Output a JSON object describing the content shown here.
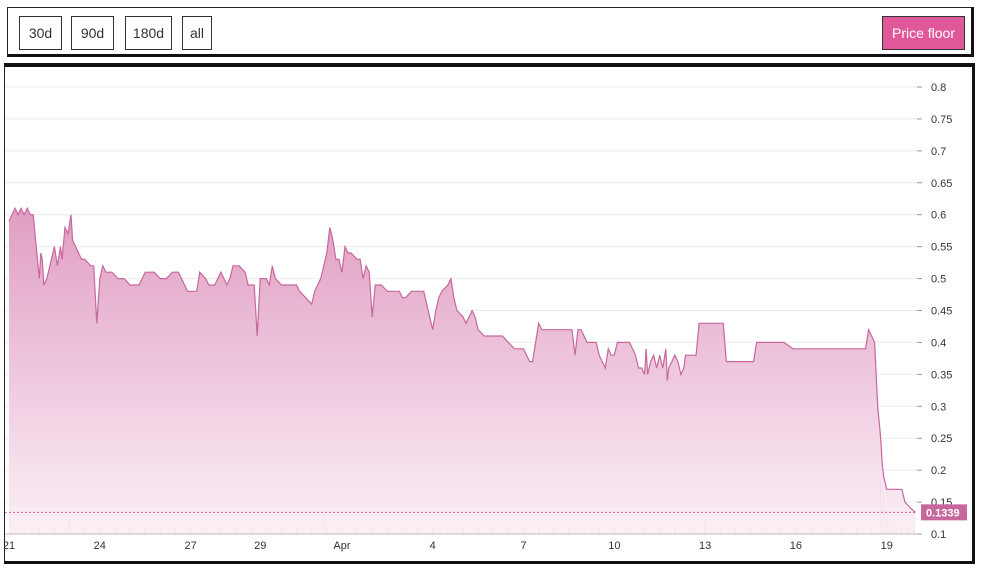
{
  "toolbar": {
    "range_buttons": [
      {
        "label": "30d",
        "active": true
      },
      {
        "label": "90d",
        "active": false
      },
      {
        "label": "180d",
        "active": false
      },
      {
        "label": "all",
        "active": false
      }
    ],
    "price_floor_label": "Price floor"
  },
  "colors": {
    "accent": "#e0589a",
    "line": "#c8679d",
    "fill": "#e4a3c6",
    "volume": "#c9a3b8"
  },
  "chart_data": {
    "type": "area",
    "title": "",
    "xlabel": "",
    "ylabel": "",
    "ylim": [
      0.1,
      0.8
    ],
    "y_ticks": [
      "0.1",
      "0.15",
      "0.2",
      "0.25",
      "0.3",
      "0.35",
      "0.4",
      "0.45",
      "0.5",
      "0.55",
      "0.6",
      "0.65",
      "0.7",
      "0.75",
      "0.8"
    ],
    "x_ticks": [
      {
        "label": "21",
        "day": 0
      },
      {
        "label": "24",
        "day": 3
      },
      {
        "label": "27",
        "day": 6
      },
      {
        "label": "29",
        "day": 8.3
      },
      {
        "label": "Apr",
        "day": 11
      },
      {
        "label": "4",
        "day": 14
      },
      {
        "label": "7",
        "day": 17
      },
      {
        "label": "10",
        "day": 20
      },
      {
        "label": "13",
        "day": 23
      },
      {
        "label": "16",
        "day": 26
      },
      {
        "label": "19",
        "day": 29
      }
    ],
    "current_price_label": "0.1339",
    "current_price": 0.1339,
    "grid": true,
    "series": [
      {
        "points": [
          [
            0,
            0.59
          ],
          [
            0.1,
            0.6
          ],
          [
            0.2,
            0.61
          ],
          [
            0.3,
            0.6
          ],
          [
            0.4,
            0.61
          ],
          [
            0.5,
            0.6
          ],
          [
            0.6,
            0.61
          ],
          [
            0.7,
            0.6
          ],
          [
            0.8,
            0.6
          ],
          [
            0.9,
            0.55
          ],
          [
            1.0,
            0.5
          ],
          [
            1.05,
            0.54
          ],
          [
            1.1,
            0.53
          ],
          [
            1.15,
            0.49
          ],
          [
            1.25,
            0.5
          ],
          [
            1.4,
            0.53
          ],
          [
            1.5,
            0.55
          ],
          [
            1.6,
            0.52
          ],
          [
            1.7,
            0.55
          ],
          [
            1.75,
            0.53
          ],
          [
            1.85,
            0.58
          ],
          [
            1.95,
            0.57
          ],
          [
            2.05,
            0.6
          ],
          [
            2.1,
            0.56
          ],
          [
            2.2,
            0.55
          ],
          [
            2.3,
            0.54
          ],
          [
            2.4,
            0.53
          ],
          [
            2.5,
            0.53
          ],
          [
            2.7,
            0.52
          ],
          [
            2.8,
            0.52
          ],
          [
            2.9,
            0.43
          ],
          [
            3.0,
            0.5
          ],
          [
            3.1,
            0.52
          ],
          [
            3.2,
            0.51
          ],
          [
            3.4,
            0.51
          ],
          [
            3.6,
            0.5
          ],
          [
            3.8,
            0.5
          ],
          [
            4.0,
            0.49
          ],
          [
            4.3,
            0.49
          ],
          [
            4.5,
            0.51
          ],
          [
            4.8,
            0.51
          ],
          [
            5.0,
            0.5
          ],
          [
            5.2,
            0.5
          ],
          [
            5.4,
            0.51
          ],
          [
            5.6,
            0.51
          ],
          [
            5.7,
            0.5
          ],
          [
            5.9,
            0.48
          ],
          [
            6.0,
            0.48
          ],
          [
            6.2,
            0.48
          ],
          [
            6.3,
            0.51
          ],
          [
            6.5,
            0.5
          ],
          [
            6.6,
            0.49
          ],
          [
            6.8,
            0.49
          ],
          [
            6.9,
            0.5
          ],
          [
            7.0,
            0.51
          ],
          [
            7.2,
            0.49
          ],
          [
            7.3,
            0.5
          ],
          [
            7.4,
            0.52
          ],
          [
            7.6,
            0.52
          ],
          [
            7.8,
            0.51
          ],
          [
            7.9,
            0.49
          ],
          [
            8.1,
            0.49
          ],
          [
            8.2,
            0.41
          ],
          [
            8.3,
            0.5
          ],
          [
            8.5,
            0.5
          ],
          [
            8.6,
            0.49
          ],
          [
            8.7,
            0.52
          ],
          [
            8.8,
            0.5
          ],
          [
            9.0,
            0.49
          ],
          [
            9.3,
            0.49
          ],
          [
            9.5,
            0.49
          ],
          [
            9.6,
            0.48
          ],
          [
            9.8,
            0.47
          ],
          [
            10.0,
            0.46
          ],
          [
            10.1,
            0.48
          ],
          [
            10.3,
            0.5
          ],
          [
            10.5,
            0.54
          ],
          [
            10.6,
            0.58
          ],
          [
            10.7,
            0.56
          ],
          [
            10.8,
            0.53
          ],
          [
            10.9,
            0.53
          ],
          [
            11.0,
            0.51
          ],
          [
            11.1,
            0.55
          ],
          [
            11.2,
            0.54
          ],
          [
            11.3,
            0.54
          ],
          [
            11.5,
            0.53
          ],
          [
            11.6,
            0.53
          ],
          [
            11.7,
            0.5
          ],
          [
            11.8,
            0.52
          ],
          [
            11.9,
            0.51
          ],
          [
            12.0,
            0.44
          ],
          [
            12.1,
            0.49
          ],
          [
            12.3,
            0.49
          ],
          [
            12.5,
            0.48
          ],
          [
            12.7,
            0.48
          ],
          [
            12.9,
            0.48
          ],
          [
            13.0,
            0.47
          ],
          [
            13.1,
            0.47
          ],
          [
            13.3,
            0.48
          ],
          [
            13.5,
            0.48
          ],
          [
            13.7,
            0.48
          ],
          [
            13.8,
            0.46
          ],
          [
            14.0,
            0.42
          ],
          [
            14.1,
            0.45
          ],
          [
            14.2,
            0.47
          ],
          [
            14.3,
            0.48
          ],
          [
            14.5,
            0.49
          ],
          [
            14.6,
            0.5
          ],
          [
            14.7,
            0.47
          ],
          [
            14.8,
            0.45
          ],
          [
            15.0,
            0.44
          ],
          [
            15.1,
            0.43
          ],
          [
            15.2,
            0.44
          ],
          [
            15.3,
            0.45
          ],
          [
            15.4,
            0.44
          ],
          [
            15.5,
            0.42
          ],
          [
            15.7,
            0.41
          ],
          [
            15.9,
            0.41
          ],
          [
            16.1,
            0.41
          ],
          [
            16.3,
            0.41
          ],
          [
            16.5,
            0.4
          ],
          [
            16.7,
            0.39
          ],
          [
            16.9,
            0.39
          ],
          [
            17.0,
            0.39
          ],
          [
            17.1,
            0.38
          ],
          [
            17.2,
            0.37
          ],
          [
            17.3,
            0.37
          ],
          [
            17.4,
            0.4
          ],
          [
            17.5,
            0.43
          ],
          [
            17.6,
            0.42
          ],
          [
            17.8,
            0.42
          ],
          [
            18.0,
            0.42
          ],
          [
            18.2,
            0.42
          ],
          [
            18.4,
            0.42
          ],
          [
            18.6,
            0.42
          ],
          [
            18.7,
            0.38
          ],
          [
            18.8,
            0.42
          ],
          [
            18.9,
            0.42
          ],
          [
            19.0,
            0.41
          ],
          [
            19.1,
            0.4
          ],
          [
            19.3,
            0.4
          ],
          [
            19.4,
            0.4
          ],
          [
            19.5,
            0.38
          ],
          [
            19.6,
            0.37
          ],
          [
            19.7,
            0.36
          ],
          [
            19.8,
            0.39
          ],
          [
            19.9,
            0.38
          ],
          [
            20.0,
            0.38
          ],
          [
            20.1,
            0.4
          ],
          [
            20.3,
            0.4
          ],
          [
            20.5,
            0.4
          ],
          [
            20.6,
            0.39
          ],
          [
            20.7,
            0.38
          ],
          [
            20.8,
            0.36
          ],
          [
            20.9,
            0.36
          ],
          [
            21.0,
            0.35
          ],
          [
            21.05,
            0.39
          ],
          [
            21.1,
            0.35
          ],
          [
            21.2,
            0.37
          ],
          [
            21.3,
            0.38
          ],
          [
            21.4,
            0.36
          ],
          [
            21.5,
            0.38
          ],
          [
            21.6,
            0.36
          ],
          [
            21.7,
            0.39
          ],
          [
            21.75,
            0.34
          ],
          [
            21.8,
            0.36
          ],
          [
            21.9,
            0.37
          ],
          [
            22.0,
            0.38
          ],
          [
            22.1,
            0.37
          ],
          [
            22.2,
            0.35
          ],
          [
            22.3,
            0.36
          ],
          [
            22.35,
            0.38
          ],
          [
            22.5,
            0.38
          ],
          [
            22.7,
            0.38
          ],
          [
            22.8,
            0.43
          ],
          [
            23.0,
            0.43
          ],
          [
            23.2,
            0.43
          ],
          [
            23.4,
            0.43
          ],
          [
            23.6,
            0.43
          ],
          [
            23.7,
            0.37
          ],
          [
            24.0,
            0.37
          ],
          [
            24.3,
            0.37
          ],
          [
            24.6,
            0.37
          ],
          [
            24.7,
            0.4
          ],
          [
            25.0,
            0.4
          ],
          [
            25.3,
            0.4
          ],
          [
            25.6,
            0.4
          ],
          [
            25.9,
            0.39
          ],
          [
            26.2,
            0.39
          ],
          [
            26.5,
            0.39
          ],
          [
            26.8,
            0.39
          ],
          [
            27.0,
            0.39
          ],
          [
            27.3,
            0.39
          ],
          [
            27.6,
            0.39
          ],
          [
            27.8,
            0.39
          ],
          [
            28.0,
            0.39
          ],
          [
            28.3,
            0.39
          ],
          [
            28.4,
            0.42
          ],
          [
            28.5,
            0.41
          ],
          [
            28.6,
            0.4
          ],
          [
            28.7,
            0.3
          ],
          [
            28.8,
            0.25
          ],
          [
            28.85,
            0.21
          ],
          [
            28.9,
            0.19
          ],
          [
            29.0,
            0.17
          ],
          [
            29.2,
            0.17
          ],
          [
            29.5,
            0.17
          ],
          [
            29.6,
            0.15
          ],
          [
            29.8,
            0.14
          ],
          [
            29.95,
            0.1339
          ]
        ]
      }
    ],
    "volume": [
      [
        0.5,
        0.01
      ],
      [
        1.0,
        0.01
      ],
      [
        1.5,
        0.01
      ],
      [
        2.0,
        0.02
      ],
      [
        2.5,
        0.01
      ],
      [
        3.0,
        0.01
      ],
      [
        3.5,
        0.01
      ],
      [
        4.0,
        0.01
      ],
      [
        4.5,
        0.01
      ],
      [
        5.0,
        0.01
      ],
      [
        5.5,
        0.01
      ],
      [
        6.0,
        0.01
      ],
      [
        6.5,
        0.01
      ],
      [
        7.0,
        0.01
      ],
      [
        7.5,
        0.01
      ],
      [
        8.0,
        0.01
      ],
      [
        8.5,
        0.01
      ],
      [
        9.0,
        0.01
      ],
      [
        9.5,
        0.01
      ],
      [
        10.0,
        0.01
      ],
      [
        10.4,
        0.03
      ],
      [
        10.5,
        0.01
      ],
      [
        11.0,
        0.01
      ],
      [
        11.5,
        0.01
      ],
      [
        12.0,
        0.01
      ],
      [
        12.5,
        0.01
      ],
      [
        13.0,
        0.01
      ],
      [
        13.5,
        0.01
      ],
      [
        14.0,
        0.01
      ],
      [
        14.5,
        0.01
      ],
      [
        15.0,
        0.01
      ],
      [
        15.5,
        0.01
      ],
      [
        16.0,
        0.01
      ],
      [
        16.5,
        0.01
      ],
      [
        17.0,
        0.01
      ],
      [
        17.5,
        0.01
      ],
      [
        18.0,
        0.01
      ],
      [
        18.5,
        0.01
      ],
      [
        19.0,
        0.01
      ],
      [
        19.5,
        0.01
      ],
      [
        20.0,
        0.01
      ],
      [
        20.5,
        0.01
      ],
      [
        21.0,
        0.01
      ],
      [
        21.5,
        0.01
      ],
      [
        22.0,
        0.01
      ],
      [
        22.5,
        0.01
      ],
      [
        23.0,
        0.02
      ],
      [
        23.5,
        0.01
      ],
      [
        24.0,
        0.01
      ],
      [
        24.5,
        0.01
      ],
      [
        25.0,
        0.01
      ],
      [
        25.5,
        0.01
      ],
      [
        26.0,
        0.01
      ],
      [
        26.5,
        0.01
      ],
      [
        27.0,
        0.01
      ],
      [
        27.5,
        0.01
      ],
      [
        28.0,
        0.01
      ],
      [
        28.5,
        0.01
      ],
      [
        28.8,
        0.07
      ],
      [
        28.9,
        0.05
      ],
      [
        29.0,
        0.035
      ],
      [
        29.1,
        0.025
      ],
      [
        29.2,
        0.015
      ],
      [
        29.3,
        0.01
      ],
      [
        29.5,
        0.01
      ],
      [
        29.7,
        0.01
      ],
      [
        29.9,
        0.01
      ]
    ]
  }
}
